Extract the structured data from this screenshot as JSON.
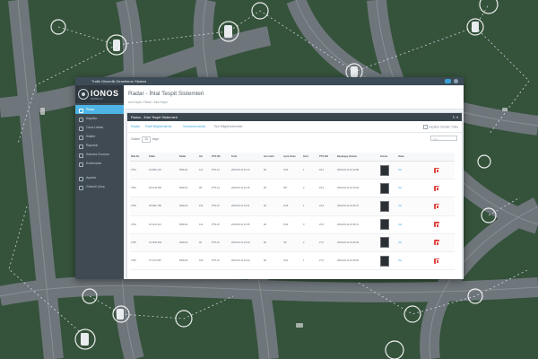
{
  "window": {
    "title": "Trafik Güvenlik Denetleme Sistemi"
  },
  "brand": {
    "name": "IONOS",
    "tagline": "TEKNOLOJİ"
  },
  "sidebar": {
    "items": [
      {
        "label": "Radar"
      },
      {
        "label": "Kayıtlar"
      },
      {
        "label": "Ceza Listesi"
      },
      {
        "label": "İhlaller"
      },
      {
        "label": "Raporlar"
      },
      {
        "label": "Kamera Durumu"
      },
      {
        "label": "Kullanıcılar"
      },
      {
        "label": "Ayarlar"
      },
      {
        "label": "Güvenli Çıkış"
      }
    ]
  },
  "page": {
    "title": "Radar - İhlal Tespit Sistemleri",
    "breadcrumb": "Ana Sayfa / Radar / İhlal Tespit"
  },
  "panel": {
    "title": "Radar - İhlal Tespit Sistemleri",
    "controls": "↻ ▾"
  },
  "tabs": [
    {
      "label": "Radar"
    },
    {
      "label": "Pasif Bilgilendirme"
    },
    {
      "label": "Sonlandırılanlar"
    },
    {
      "label": "Tüm Bilgilendirmeler"
    }
  ],
  "tabs_right": "Kayıtları Yeniden Yükle",
  "table_tools": {
    "show_prefix": "Göster",
    "page_length": "10",
    "show_suffix": "kayıt",
    "search_placeholder": "Ara..."
  },
  "table": {
    "columns": [
      "İhlal No",
      "Plaka",
      "Radar",
      "Hız",
      "PTS NO",
      "Tarih",
      "Hız Limiti",
      "Aşım Oranı",
      "Şerit",
      "PTS KM",
      "Başlangıç Zamanı",
      "Görsel",
      "Video",
      ""
    ],
    "rows": [
      {
        "id": "3751",
        "plate": "34 ABC 123",
        "radar": "RDR-01",
        "speed": "112",
        "pts": "PTS-14",
        "date": "2019-06-12 10:14",
        "limit": "90",
        "excess": "%24",
        "lane": "1",
        "km": "18,2",
        "start": "2019-06-12 10:13:58",
        "video": "İzle"
      },
      {
        "id": "3752",
        "plate": "06 KLM 456",
        "radar": "RDR-01",
        "speed": "98",
        "pts": "PTS-14",
        "date": "2019-06-12 10:16",
        "limit": "90",
        "excess": "%8",
        "lane": "2",
        "km": "18,2",
        "start": "2019-06-12 10:16:02",
        "video": "İzle"
      },
      {
        "id": "3753",
        "plate": "35 DEF 789",
        "radar": "RDR-02",
        "speed": "104",
        "pts": "PTS-15",
        "date": "2019-06-12 10:21",
        "limit": "90",
        "excess": "%15",
        "lane": "1",
        "km": "22,5",
        "start": "2019-06-12 10:20:47",
        "video": "İzle"
      },
      {
        "id": "3754",
        "plate": "16 GHJ 321",
        "radar": "RDR-02",
        "speed": "121",
        "pts": "PTS-15",
        "date": "2019-06-12 10:25",
        "limit": "90",
        "excess": "%34",
        "lane": "3",
        "km": "22,5",
        "start": "2019-06-12 10:25:11",
        "video": "İzle"
      },
      {
        "id": "3755",
        "plate": "41 NPR 654",
        "radar": "RDR-03",
        "speed": "96",
        "pts": "PTS-16",
        "date": "2019-06-12 10:30",
        "limit": "90",
        "excess": "%6",
        "lane": "2",
        "km": "27,0",
        "start": "2019-06-12 10:29:39",
        "video": "İzle"
      },
      {
        "id": "3756",
        "plate": "07 STU 987",
        "radar": "RDR-03",
        "speed": "109",
        "pts": "PTS-16",
        "date": "2019-06-12 10:34",
        "limit": "90",
        "excess": "%21",
        "lane": "1",
        "km": "27,0",
        "start": "2019-06-12 10:33:50",
        "video": "İzle"
      }
    ]
  },
  "colors": {
    "accent": "#4db4e3",
    "sidebar": "#3f4a52",
    "panel_header": "#3a454d",
    "delete": "#e0453e",
    "link": "#3fa8dd"
  }
}
